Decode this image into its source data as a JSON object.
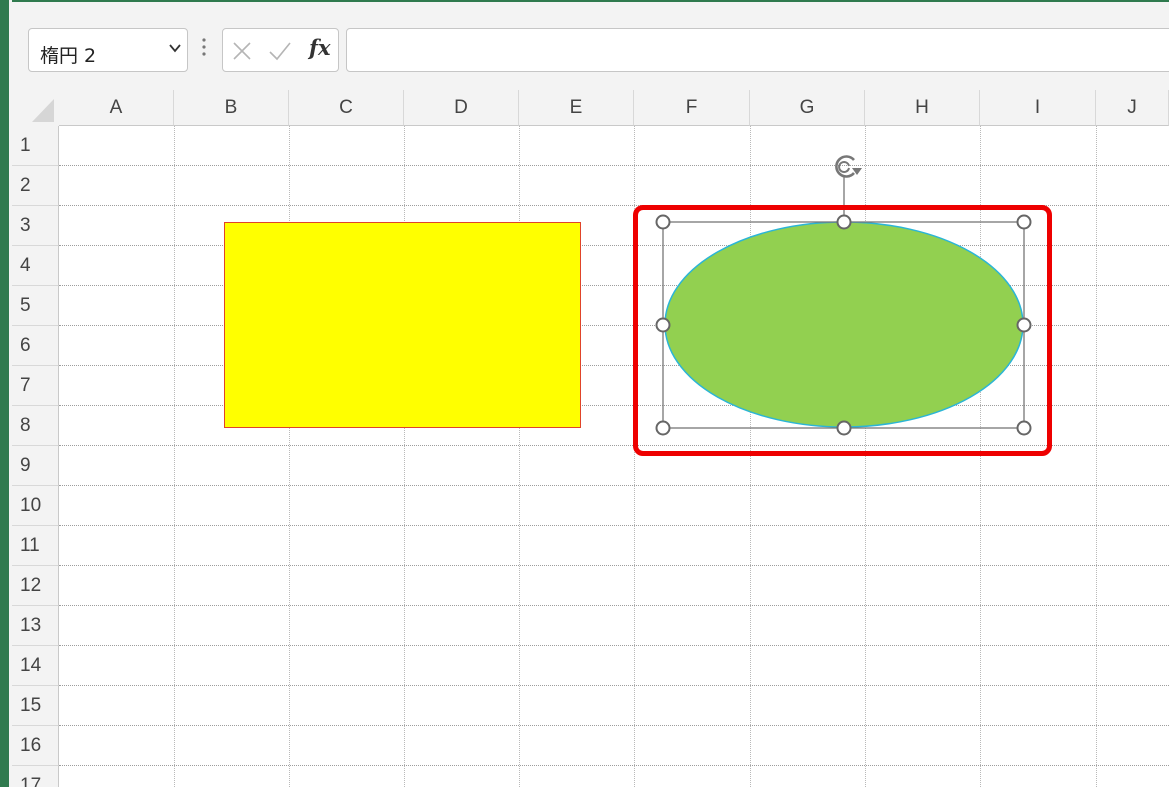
{
  "name_box": {
    "value": "楕円 2"
  },
  "formula_bar": {
    "fx_label": "fx",
    "value": ""
  },
  "columns": [
    "A",
    "B",
    "C",
    "D",
    "E",
    "F",
    "G",
    "H",
    "I",
    "J"
  ],
  "rows": [
    "1",
    "2",
    "3",
    "4",
    "5",
    "6",
    "7",
    "8",
    "9",
    "10",
    "11",
    "12",
    "13",
    "14",
    "15",
    "16",
    "17"
  ],
  "shapes": {
    "rectangle": {
      "fill": "#ffff00",
      "outline": "#e0442a"
    },
    "ellipse": {
      "name": "楕円 2",
      "fill": "#92d050",
      "outline": "#2bb5d6",
      "selected": true
    }
  },
  "highlight": {
    "color": "#ee0000"
  },
  "icons": {
    "name_box_dropdown": "chevron-down-icon",
    "formula_options": "kebab-icon",
    "cancel": "close-icon",
    "enter": "check-icon",
    "rotate": "rotate-icon"
  }
}
